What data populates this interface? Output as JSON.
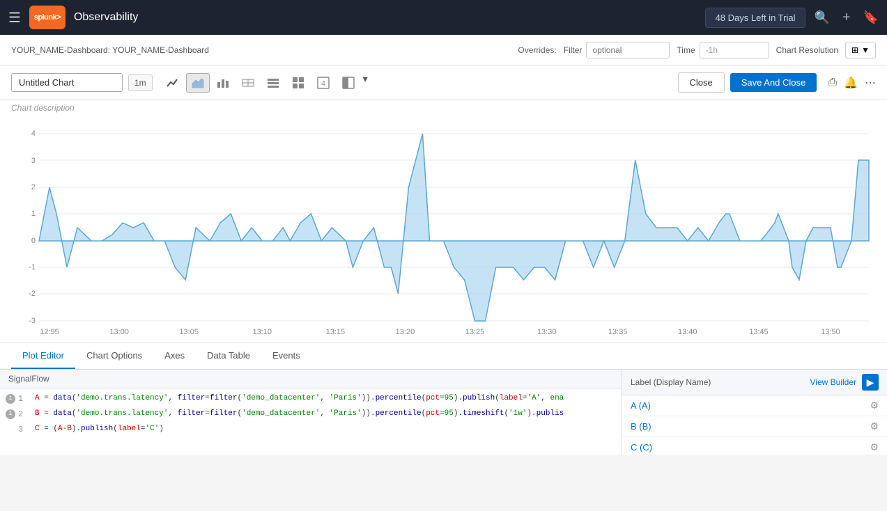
{
  "navbar": {
    "logo_text": "splunk>",
    "title": "Observability",
    "trial_text": "48 Days Left in Trial",
    "icons": [
      "search",
      "plus",
      "bookmark"
    ]
  },
  "breadcrumb": {
    "text": "YOUR_NAME-Dashboard: YOUR_NAME-Dashboard"
  },
  "overrides": {
    "label": "Overrides:",
    "filter_label": "Filter",
    "filter_placeholder": "optional",
    "time_label": "Time",
    "time_value": "-1h",
    "chart_resolution_label": "Chart Resolution"
  },
  "chart_editor": {
    "chart_name": "Untitled Chart",
    "time_btn": "1m",
    "description_placeholder": "Chart description",
    "close_btn": "Close",
    "save_close_btn": "Save And Close"
  },
  "chart_types": [
    {
      "name": "line-chart-icon",
      "symbol": "📈",
      "active": false
    },
    {
      "name": "area-chart-icon",
      "symbol": "⬛",
      "active": true
    },
    {
      "name": "bar-chart-icon",
      "symbol": "📊",
      "active": false
    },
    {
      "name": "column-chart-icon",
      "symbol": "☰",
      "active": false
    },
    {
      "name": "list-chart-icon",
      "symbol": "≡",
      "active": false
    },
    {
      "name": "heatmap-icon",
      "symbol": "⊞",
      "active": false
    },
    {
      "name": "single-value-icon",
      "symbol": "①",
      "active": false
    },
    {
      "name": "gauge-icon",
      "symbol": "◧",
      "active": false
    }
  ],
  "y_axis": {
    "values": [
      "4",
      "3",
      "2",
      "1",
      "0",
      "-1",
      "-2",
      "-3"
    ]
  },
  "x_axis": {
    "labels": [
      "12:55",
      "13:00",
      "13:05",
      "13:10",
      "13:15",
      "13:20",
      "13:25",
      "13:30",
      "13:35",
      "13:40",
      "13:45",
      "13:50"
    ]
  },
  "tabs": [
    {
      "id": "plot-editor",
      "label": "Plot Editor",
      "active": true
    },
    {
      "id": "chart-options",
      "label": "Chart Options",
      "active": false
    },
    {
      "id": "axes",
      "label": "Axes",
      "active": false
    },
    {
      "id": "data-table",
      "label": "Data Table",
      "active": false
    },
    {
      "id": "events",
      "label": "Events",
      "active": false
    }
  ],
  "signal_flow": {
    "header": "SignalFlow",
    "lines": [
      {
        "num": "1",
        "has_info": true,
        "code": "A = data('demo.trans.latency', filter=filter('demo_datacenter', 'Paris')).percentile(pct=95).publish(label='A', ena"
      },
      {
        "num": "2",
        "has_info": true,
        "code": "B = data('demo.trans.latency', filter=filter('demo_datacenter', 'Paris')).percentile(pct=95).timeshift('1w').publis"
      },
      {
        "num": "3",
        "has_info": false,
        "code": "C = (A-B).publish(label='C')"
      }
    ]
  },
  "labels_panel": {
    "header": "Label (Display Name)",
    "view_builder": "View Builder",
    "labels": [
      {
        "text": "A (A)"
      },
      {
        "text": "B (B)"
      },
      {
        "text": "C (C)"
      }
    ]
  }
}
